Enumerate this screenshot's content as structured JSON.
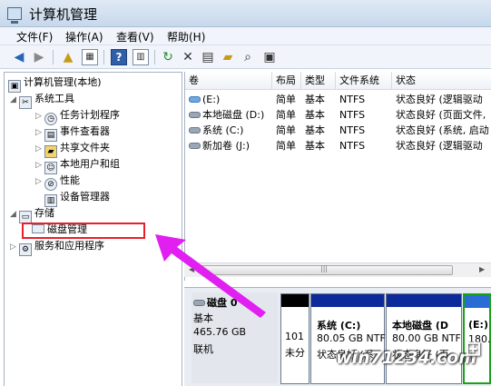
{
  "window": {
    "title": "计算机管理"
  },
  "menu": [
    "文件(F)",
    "操作(A)",
    "查看(V)",
    "帮助(H)"
  ],
  "tree": {
    "root": "计算机管理(本地)",
    "system_tools": "系统工具",
    "task_scheduler": "任务计划程序",
    "event_viewer": "事件查看器",
    "shared_folders": "共享文件夹",
    "local_users": "本地用户和组",
    "performance": "性能",
    "device_manager": "设备管理器",
    "storage": "存储",
    "disk_management": "磁盘管理",
    "services": "服务和应用程序"
  },
  "columns": [
    "卷",
    "布局",
    "类型",
    "文件系统",
    "状态"
  ],
  "volumes": [
    {
      "name": "(E:)",
      "layout": "简单",
      "type": "基本",
      "fs": "NTFS",
      "status": "状态良好 (逻辑驱动",
      "icon": "blue"
    },
    {
      "name": "本地磁盘 (D:)",
      "layout": "简单",
      "type": "基本",
      "fs": "NTFS",
      "status": "状态良好 (页面文件,",
      "icon": "grey"
    },
    {
      "name": "系统 (C:)",
      "layout": "简单",
      "type": "基本",
      "fs": "NTFS",
      "status": "状态良好 (系统, 启动",
      "icon": "grey"
    },
    {
      "name": "新加卷 (J:)",
      "layout": "简单",
      "type": "基本",
      "fs": "NTFS",
      "status": "状态良好 (逻辑驱动",
      "icon": "grey"
    }
  ],
  "disk0": {
    "name": "磁盘 0",
    "kind": "基本",
    "size": "465.76 GB",
    "state": "联机"
  },
  "partitions": {
    "unalloc": {
      "line1": "101",
      "line2": "未分"
    },
    "c": {
      "name": "系统 (C:)",
      "size": "80.05 GB NTF",
      "status": "状态良好 (系"
    },
    "d": {
      "name": "本地磁盘 (D",
      "size": "80.00 GB NTF",
      "status": "状态良好 (页"
    },
    "e": {
      "name": "(E:)",
      "size": "180.0"
    }
  },
  "watermark": "win71234.com"
}
